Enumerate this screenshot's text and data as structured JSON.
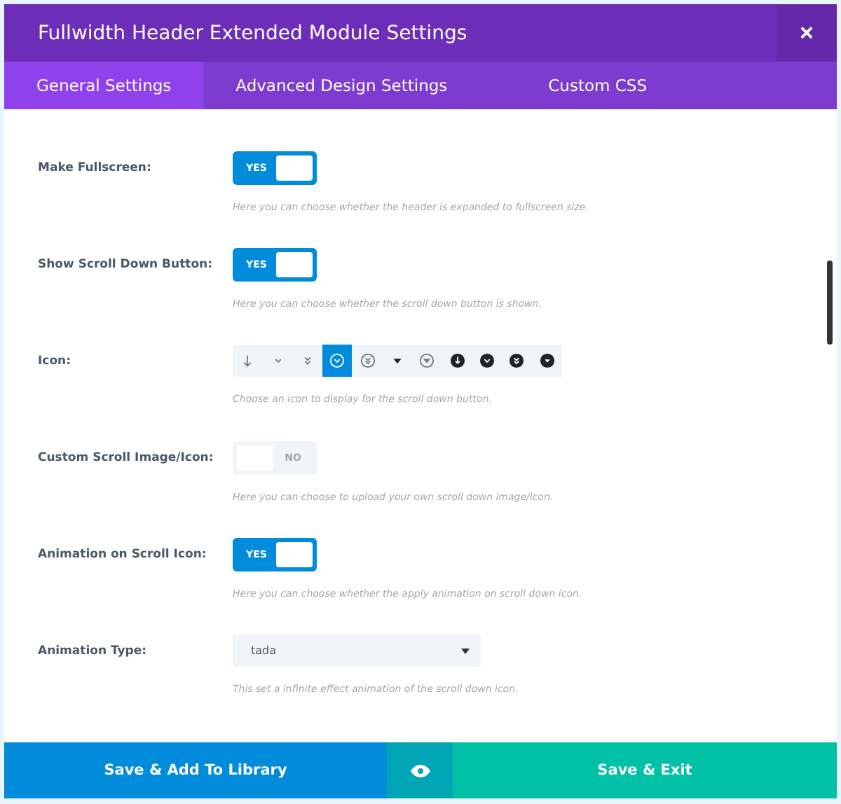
{
  "window": {
    "title": "Fullwidth Header Extended Module Settings",
    "close": "×"
  },
  "tabs": [
    {
      "label": "General Settings",
      "selected": true
    },
    {
      "label": "Advanced Design Settings",
      "selected": false
    },
    {
      "label": "Custom CSS",
      "selected": false
    }
  ],
  "settings": [
    {
      "kind": "toggle",
      "label": "Make Fullscreen:",
      "on": true,
      "text": "YES",
      "description": "Here you can choose whether the header is expanded to fullscreen size."
    },
    {
      "kind": "toggle",
      "label": "Show Scroll Down Button:",
      "on": true,
      "text": "YES",
      "description": "Here you can choose whether the scroll down button is shown."
    },
    {
      "kind": "icons",
      "label": "Icon:",
      "options": [
        {
          "kind": "arrow",
          "selected": false
        },
        {
          "kind": "chevron",
          "selected": false
        },
        {
          "kind": "double-chevron",
          "selected": false
        },
        {
          "kind": "circle-chevron",
          "selected": true
        },
        {
          "kind": "circle-double-chevron",
          "selected": false
        },
        {
          "kind": "triangle",
          "selected": false
        },
        {
          "kind": "circle-triangle",
          "selected": false
        },
        {
          "kind": "filled-arrow",
          "selected": false
        },
        {
          "kind": "filled-chevron",
          "selected": false
        },
        {
          "kind": "filled-double-chevron",
          "selected": false
        },
        {
          "kind": "filled-triangle",
          "selected": false
        }
      ],
      "description": "Choose an icon to display for the scroll down button."
    },
    {
      "kind": "toggle",
      "label": "Custom Scroll Image/Icon:",
      "on": false,
      "text": "NO",
      "description": "Here you can choose to upload your own scroll down image/icon."
    },
    {
      "kind": "toggle",
      "label": "Animation on Scroll Icon:",
      "on": true,
      "text": "YES",
      "description": "Here you can choose whether the apply animation on scroll down icon."
    },
    {
      "kind": "select",
      "label": "Animation Type:",
      "value": "tada",
      "description": "This set a infinite effect animation of the scroll down icon."
    }
  ],
  "footer": {
    "library_button": "Save & Add To Library",
    "exit_button": "Save & Exit"
  }
}
